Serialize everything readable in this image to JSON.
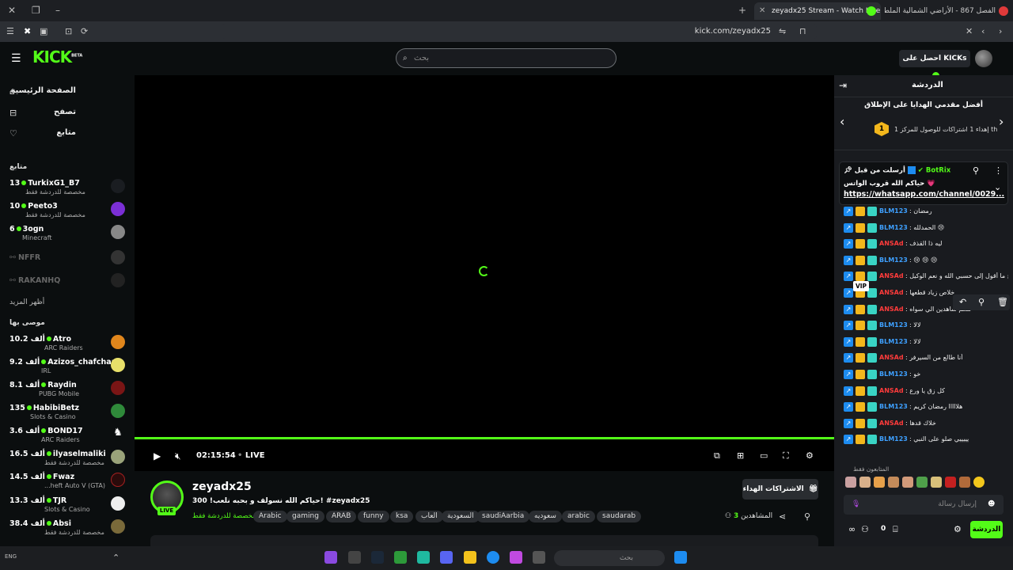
{
  "browser": {
    "tabs": [
      {
        "title": "zeyadx25 Stream - Watch Live o...",
        "active": true
      },
      {
        "title": "الفصل 867 - الأراضي الشمالية الملطخة",
        "active": false
      }
    ],
    "url": "kick.com/zeyadx25"
  },
  "header": {
    "logo": "KICK",
    "logo_beta": "BETA",
    "search_placeholder": "بحث",
    "get_kicks": "احصل على KICKs"
  },
  "sidebar": {
    "nav": [
      {
        "label": "الصفحة الرئيسية",
        "icon": "home-icon"
      },
      {
        "label": "تصفح",
        "icon": "browse-icon"
      },
      {
        "label": "متابع",
        "icon": "heart-icon"
      }
    ],
    "following_title": "متابع",
    "following": [
      {
        "viewers": "13",
        "name": "TurkixG1_B7",
        "sub": "مخصصة للدردشة فقط",
        "live": true
      },
      {
        "viewers": "10",
        "name": "Peeto3",
        "sub": "مخصصة للدردشة فقط",
        "live": true
      },
      {
        "viewers": "6",
        "name": "3ogn",
        "sub": "Minecraft",
        "live": true
      },
      {
        "viewers": "",
        "name": "NFFR",
        "sub": "",
        "live": false
      },
      {
        "viewers": "",
        "name": "RAKANHQ",
        "sub": "",
        "live": false
      }
    ],
    "show_more": "أظهر المزيد",
    "recommended_title": "موصى بها",
    "recommended": [
      {
        "viewers": "10.2 ألف",
        "name": "Atro",
        "sub": "ARC Raiders"
      },
      {
        "viewers": "9.2 ألف",
        "name": "Azizos_chafchaa",
        "sub": "IRL"
      },
      {
        "viewers": "8.1 ألف",
        "name": "Raydin",
        "sub": "PUBG Mobile"
      },
      {
        "viewers": "135",
        "name": "HabibiBetz",
        "sub": "Slots & Casino"
      },
      {
        "viewers": "3.6 ألف",
        "name": "BOND17",
        "sub": "ARC Raiders"
      },
      {
        "viewers": "16.5 ألف",
        "name": "ilyaselmaliki",
        "sub": "مخصصة للدردشة فقط"
      },
      {
        "viewers": "14.5 ألف",
        "name": "Fwaz",
        "sub": "...heft Auto V (GTA)"
      },
      {
        "viewers": "13.3 ألف",
        "name": "TJR",
        "sub": "Slots & Casino"
      },
      {
        "viewers": "38.4 ألف",
        "name": "Absi",
        "sub": "مخصصة للدردشة فقط"
      }
    ]
  },
  "player": {
    "time": "02:15:54",
    "live_label": "LIVE",
    "progress_fraction": 1.0
  },
  "stream": {
    "channel": "zeyadx25",
    "live_badge": "LIVE",
    "title": "حياكم الله نسولف و بحبه نلعب! 300! #zeyadx25",
    "category": "مخصصة للدردشة فقط",
    "tags": [
      "Arabic",
      "gaming",
      "ARAB",
      "funny",
      "ksa",
      "العاب",
      "السعودية",
      "saudiAarbia",
      "سعوديه",
      "arabic",
      "saudarab"
    ],
    "subscribe_gift": "الاشتراكات الهداء",
    "viewers_label": "المشاهدين",
    "viewers": "3"
  },
  "chat": {
    "title": "الدردشة",
    "top_gifters_title": "أفضل مقدمي الهدايا على الإطلاق",
    "gift_line": "إهداء 1 اشتراكات للوصول للمركز 1 th",
    "rank": "1",
    "pinned": {
      "sent_by": "أرسلت من قبل",
      "user": "BotRix",
      "message": "حياكم الله قروب الواتس 💗",
      "link": "https://whatsapp.com/channel/0029..."
    },
    "messages": [
      {
        "user": "BLM123",
        "color": "#3ea0ff",
        "text": "رمضان"
      },
      {
        "user": "BLM123",
        "color": "#3ea0ff",
        "text": "الحمدلله 😢"
      },
      {
        "user": "ANSAd",
        "color": "#ff3b3b",
        "text": "ليه ذا القذف"
      },
      {
        "user": "BLM123",
        "color": "#3ea0ff",
        "text": "😢 😢 😢"
      },
      {
        "user": "ANSAd",
        "color": "#ff3b3b",
        "text": "يا شيخ ما أقول إلى حسبي الله و نعم الوكيل"
      },
      {
        "user": "ANSAd",
        "color": "#ff3b3b",
        "text": "خلاص زياد قطعها"
      },
      {
        "user": "ANSAd",
        "color": "#ff3b3b",
        "text": "كلكم شاهدين الي سواه"
      },
      {
        "user": "BLM123",
        "color": "#3ea0ff",
        "text": "لالا"
      },
      {
        "user": "BLM123",
        "color": "#3ea0ff",
        "text": "لالا"
      },
      {
        "user": "ANSAd",
        "color": "#ff3b3b",
        "text": "أنا طالع من السيرفر"
      },
      {
        "user": "BLM123",
        "color": "#3ea0ff",
        "text": "خو"
      },
      {
        "user": "ANSAd",
        "color": "#ff3b3b",
        "text": "كل زق يا ورع"
      },
      {
        "user": "BLM123",
        "color": "#3ea0ff",
        "text": "هلااااا رمضان كريم"
      },
      {
        "user": "ANSAd",
        "color": "#ff3b3b",
        "text": "خلاك قدها"
      },
      {
        "user": "BLM123",
        "color": "#3ea0ff",
        "text": "يييييي صلو على النبي"
      }
    ],
    "vip_label": "VIP",
    "subscribers_only": "المتابعون فقط",
    "input_placeholder": "إرسال رسالة",
    "send_label": "الدردشة",
    "points": "0"
  },
  "taskbar": {
    "search_placeholder": "بحث",
    "status_text": "ENG"
  }
}
